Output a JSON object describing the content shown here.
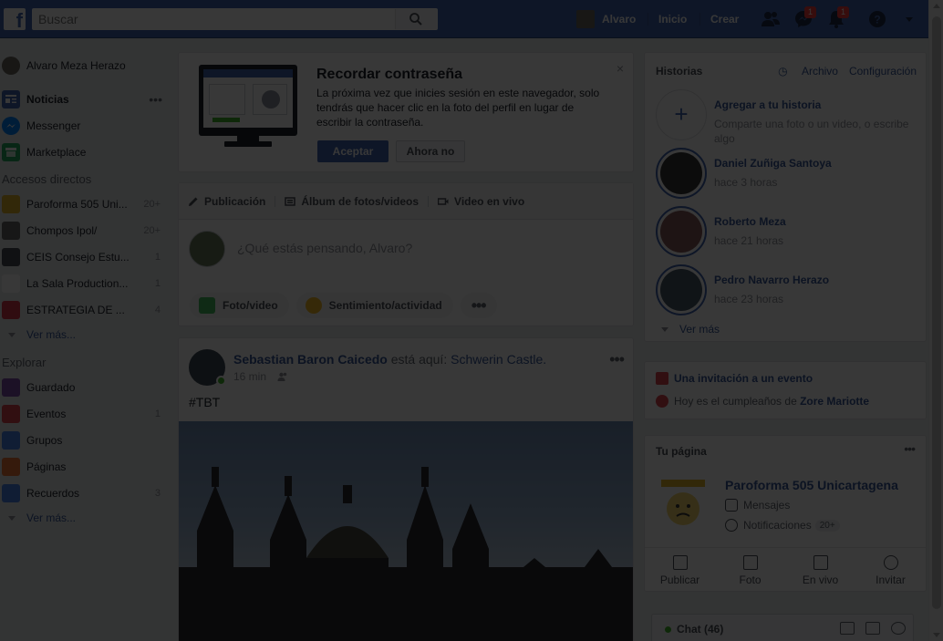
{
  "topbar": {
    "logo": "f",
    "search_placeholder": "Buscar",
    "user_name": "Alvaro",
    "home_label": "Inicio",
    "create_label": "Crear",
    "messenger_badge": "1",
    "notifications_badge": "1"
  },
  "leftnav": {
    "profile": "Alvaro Meza Herazo",
    "news": "Noticias",
    "news_more": "•••",
    "messenger": "Messenger",
    "marketplace": "Marketplace",
    "shortcuts_head": "Accesos directos",
    "shortcuts": [
      {
        "label": "Paroforma 505 Uni...",
        "count": "20+",
        "color": "#e4b52a"
      },
      {
        "label": "Chompos Ipol/",
        "count": "20+",
        "color": "#6b6b6b"
      },
      {
        "label": "CEIS Consejo Estu...",
        "count": "1",
        "color": "#4b4f56"
      },
      {
        "label": "La Sala Production...",
        "count": "1",
        "color": "#ffffff"
      },
      {
        "label": "ESTRATEGIA DE ...",
        "count": "4",
        "color": "#d93a4c"
      }
    ],
    "more1": "Ver más...",
    "explore_head": "Explorar",
    "explore": [
      {
        "label": "Guardado",
        "count": "",
        "color": "#7f4dab"
      },
      {
        "label": "Eventos",
        "count": "1",
        "color": "#e04450"
      },
      {
        "label": "Grupos",
        "count": "",
        "color": "#4b85ea"
      },
      {
        "label": "Páginas",
        "count": "",
        "color": "#f2773a"
      },
      {
        "label": "Recuerdos",
        "count": "3",
        "color": "#4b85ea"
      }
    ],
    "more2": "Ver más..."
  },
  "password_card": {
    "title": "Recordar contraseña",
    "text": "La próxima vez que inicies sesión en este navegador, solo tendrás que hacer clic en la foto del perfil en lugar de escribir la contraseña.",
    "accept": "Aceptar",
    "decline": "Ahora no",
    "close": "×"
  },
  "composer": {
    "tab_post": "Publicación",
    "tab_album": "Álbum de fotos/videos",
    "tab_live": "Video en vivo",
    "placeholder": "¿Qué estás pensando, Alvaro?",
    "opt_photo": "Foto/video",
    "opt_feeling": "Sentimiento/actividad",
    "opt_more": "•••"
  },
  "post": {
    "author": "Sebastian Baron Caicedo",
    "verb": "está aquí:",
    "place": "Schwerin Castle.",
    "time": "16 min",
    "text": "#TBT",
    "menu": "•••"
  },
  "stories": {
    "title": "Historias",
    "archive": "Archivo",
    "settings": "Configuración",
    "add_title": "Agregar a tu historia",
    "add_sub": "Comparte una foto o un video, o escribe algo",
    "items": [
      {
        "name": "Daniel Zuñiga Santoya",
        "time": "hace 3 horas"
      },
      {
        "name": "Roberto Meza",
        "time": "hace 21 horas"
      },
      {
        "name": "Pedro Navarro Herazo",
        "time": "hace 23 horas"
      }
    ],
    "see_more": "Ver más"
  },
  "events": {
    "invite": "Una invitación a un evento",
    "birthday_prefix": "Hoy es el cumpleaños de",
    "birthday_name": "Zore Mariotte"
  },
  "your_page": {
    "head": "Tu página",
    "more": "•••",
    "name": "Paroforma 505 Unicartagena",
    "messages": "Mensajes",
    "notifications": "Notificaciones",
    "notif_count": "20+",
    "actions": [
      "Publicar",
      "Foto",
      "En vivo",
      "Invitar"
    ]
  },
  "chat": {
    "label": "Chat (46)"
  }
}
